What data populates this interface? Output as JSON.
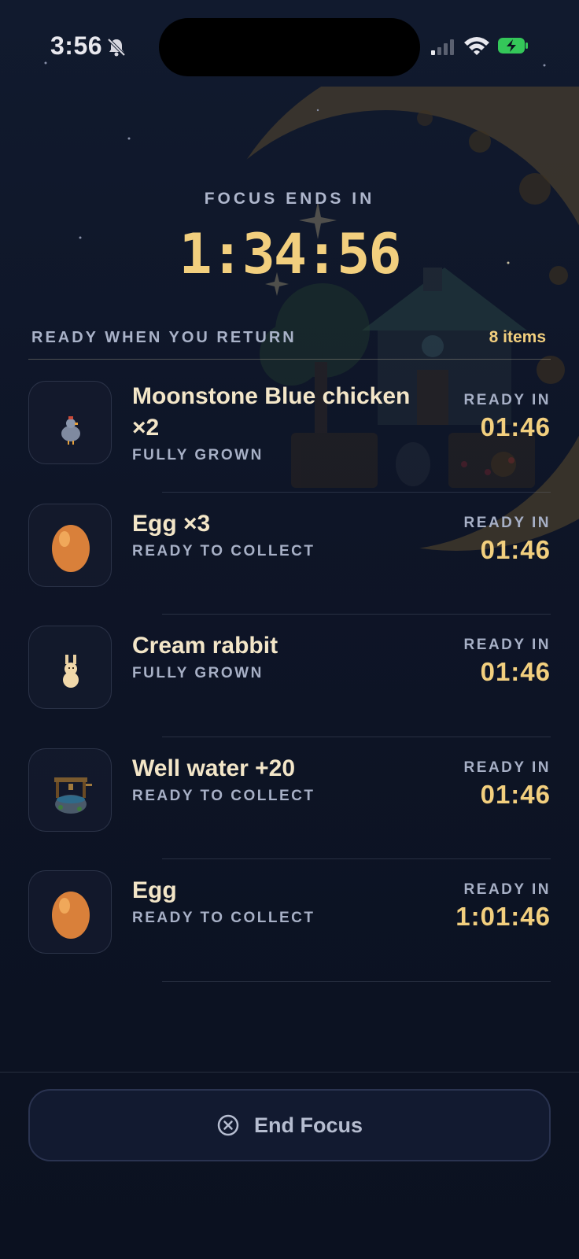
{
  "status_bar": {
    "time": "3:56",
    "icons": [
      "bell-slash-icon",
      "signal-icon",
      "wifi-icon",
      "battery-charging-icon"
    ]
  },
  "focus": {
    "label": "FOCUS ENDS IN",
    "timer": "1:34:56"
  },
  "list": {
    "header": "READY WHEN YOU RETURN",
    "count": "8 items",
    "items": [
      {
        "title": "Moonstone Blue chicken ×2",
        "subtitle": "FULLY GROWN",
        "ready_label": "READY IN",
        "ready_time": "01:46",
        "icon": "chicken-icon"
      },
      {
        "title": "Egg ×3",
        "subtitle": "READY TO COLLECT",
        "ready_label": "READY IN",
        "ready_time": "01:46",
        "icon": "egg-icon"
      },
      {
        "title": "Cream rabbit",
        "subtitle": "FULLY GROWN",
        "ready_label": "READY IN",
        "ready_time": "01:46",
        "icon": "rabbit-icon"
      },
      {
        "title": "Well water +20",
        "subtitle": "READY TO COLLECT",
        "ready_label": "READY IN",
        "ready_time": "01:46",
        "icon": "well-icon"
      },
      {
        "title": "Egg",
        "subtitle": "READY TO COLLECT",
        "ready_label": "READY IN",
        "ready_time": "1:01:46",
        "icon": "egg-icon"
      }
    ]
  },
  "end_button": {
    "label": "End Focus",
    "icon": "close-circle-icon"
  },
  "colors": {
    "accent": "#f2cf7e",
    "background": "#0c1220",
    "muted": "#a7b0c6"
  }
}
